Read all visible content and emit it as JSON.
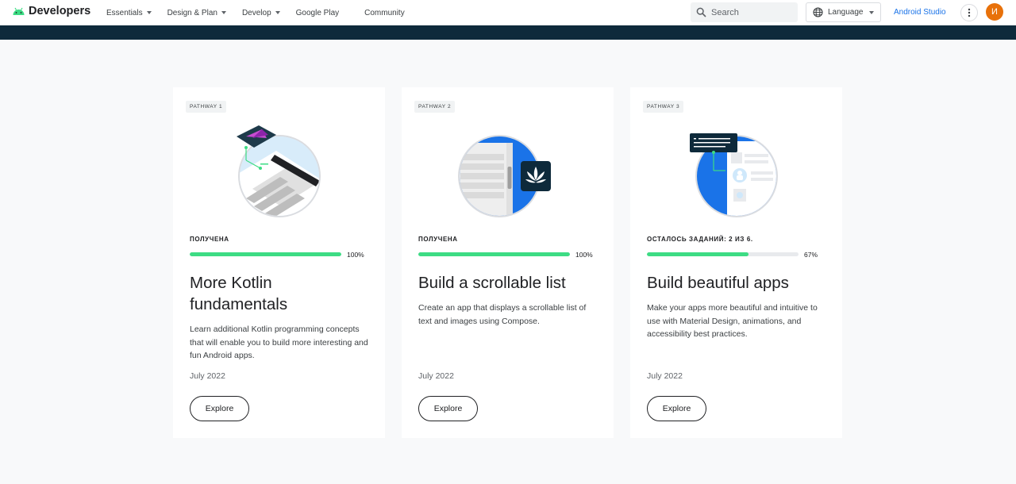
{
  "header": {
    "brand": "Developers",
    "nav": [
      {
        "label": "Essentials",
        "dropdown": true
      },
      {
        "label": "Design & Plan",
        "dropdown": true
      },
      {
        "label": "Develop",
        "dropdown": true
      },
      {
        "label": "Google Play",
        "dropdown": false
      },
      {
        "label": "Community",
        "dropdown": false
      }
    ],
    "search": {
      "placeholder": "Search"
    },
    "language": "Language",
    "studio_link": "Android Studio",
    "avatar_initial": "И"
  },
  "colors": {
    "brand_green": "#3ddc84",
    "banner": "#0e2a3b",
    "link": "#1a73e8",
    "avatar": "#e8710a"
  },
  "cards": [
    {
      "chip": "PATHWAY 1",
      "status": "ПОЛУЧЕНА",
      "progress_percent": 100,
      "progress_label": "100%",
      "title": "More Kotlin fundamentals",
      "description": "Learn additional Kotlin programming concepts that will enable you to build more interesting and fun Android apps.",
      "date": "July 2022",
      "button": "Explore"
    },
    {
      "chip": "PATHWAY 2",
      "status": "ПОЛУЧЕНА",
      "progress_percent": 100,
      "progress_label": "100%",
      "title": "Build a scrollable list",
      "description": "Create an app that displays a scrollable list of text and images using Compose.",
      "date": "July 2022",
      "button": "Explore"
    },
    {
      "chip": "PATHWAY 3",
      "status": "ОСТАЛОСЬ ЗАДАНИЙ: 2 ИЗ 6.",
      "progress_percent": 67,
      "progress_label": "67%",
      "title": "Build beautiful apps",
      "description": "Make your apps more beautiful and intuitive to use with Material Design, animations, and accessibility best practices.",
      "date": "July 2022",
      "button": "Explore"
    }
  ]
}
